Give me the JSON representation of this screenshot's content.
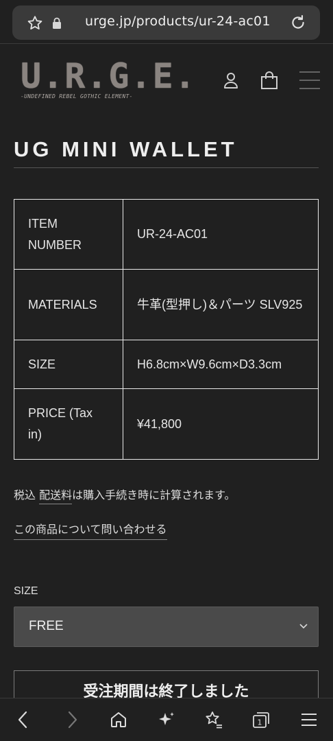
{
  "browser": {
    "url": "urge.jp/products/ur-24-ac01",
    "tab_count": "1"
  },
  "header": {
    "logo_text": "U.R.G.E.",
    "logo_subtitle": "-UNDEFINED REBEL GOTHIC ELEMENT-"
  },
  "product": {
    "title": "UG MINI WALLET",
    "specs": [
      {
        "key": "ITEM NUMBER",
        "value": "UR-24-AC01"
      },
      {
        "key": "MATERIALS",
        "value": "牛革(型押し)＆パーツ SLV925"
      },
      {
        "key": "SIZE",
        "value": "H6.8cm×W9.6cm×D3.3cm"
      },
      {
        "key": "PRICE (Tax in)",
        "value": "¥41,800"
      }
    ],
    "tax_prefix": "税込 ",
    "shipping_link": "配送料",
    "tax_suffix": "は購入手続き時に計算されます。",
    "inquiry_link": "この商品について問い合わせる",
    "size_label": "SIZE",
    "size_selected": "FREE",
    "soldout_label": "受注期間は終了しました"
  },
  "colors": {
    "background": "#202020",
    "border": "#eaeaea",
    "select_bg": "#4a4a4a"
  }
}
